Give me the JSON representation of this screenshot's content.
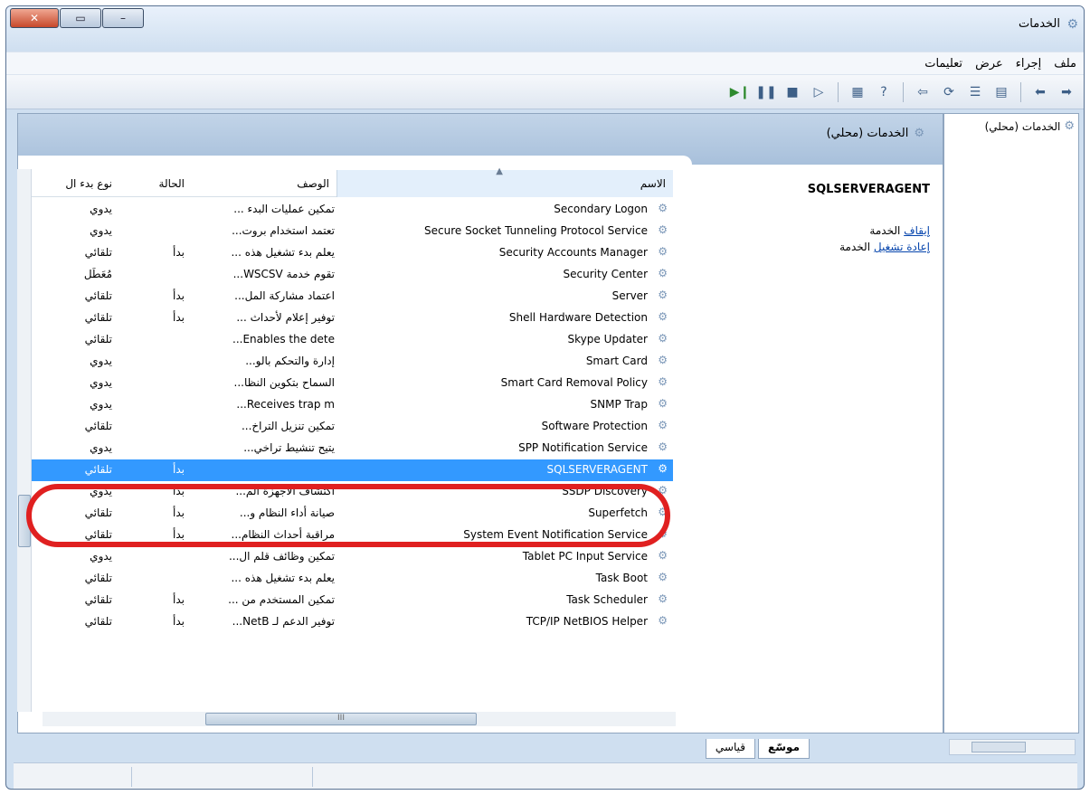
{
  "window": {
    "title": "الخدمات"
  },
  "menu": [
    "ملف",
    "إجراء",
    "عرض",
    "تعليمات"
  ],
  "tree": {
    "root": "الخدمات (محلي)"
  },
  "header": {
    "title": "الخدمات (محلي)"
  },
  "extended": {
    "service_name": "SQLSERVERAGENT",
    "stop_word": "إيقاف",
    "stop_rest": "الخدمة",
    "restart_word": "إعادة تشغيل",
    "restart_rest": "الخدمة"
  },
  "columns": {
    "name": "الاسم",
    "description": "الوصف",
    "status": "الحالة",
    "startup": "نوع بدء ال"
  },
  "rows": [
    {
      "name": "Secondary Logon",
      "desc": "تمكين عمليات البدء ...",
      "status": "",
      "startup": "يدوي"
    },
    {
      "name": "Secure Socket Tunneling Protocol Service",
      "desc": "تعتمد استخدام بروت...",
      "status": "",
      "startup": "يدوي"
    },
    {
      "name": "Security Accounts Manager",
      "desc": "يعلم بدء تشغيل هذه ...",
      "status": "بدأ",
      "startup": "تلقائي"
    },
    {
      "name": "Security Center",
      "desc": "تقوم خدمة WSCSV...",
      "status": "",
      "startup": "مُعَطَل"
    },
    {
      "name": "Server",
      "desc": "اعتماد مشاركة المل...",
      "status": "بدأ",
      "startup": "تلقائي"
    },
    {
      "name": "Shell Hardware Detection",
      "desc": "توفير إعلام لأحداث ...",
      "status": "بدأ",
      "startup": "تلقائي"
    },
    {
      "name": "Skype Updater",
      "desc": "Enables the dete...",
      "status": "",
      "startup": "تلقائي"
    },
    {
      "name": "Smart Card",
      "desc": "إدارة والتحكم بالو...",
      "status": "",
      "startup": "يدوي"
    },
    {
      "name": "Smart Card Removal Policy",
      "desc": "السماح بتكوين النظا...",
      "status": "",
      "startup": "يدوي"
    },
    {
      "name": "SNMP Trap",
      "desc": "Receives trap m...",
      "status": "",
      "startup": "يدوي"
    },
    {
      "name": "Software Protection",
      "desc": "تمكين تنزيل التراخ...",
      "status": "",
      "startup": "تلقائي"
    },
    {
      "name": "SPP Notification Service",
      "desc": "يتيح تنشيط تراخي...",
      "status": "",
      "startup": "يدوي"
    },
    {
      "name": "SQLSERVERAGENT",
      "desc": "",
      "status": "بدأ",
      "startup": "تلقائي"
    },
    {
      "name": "SSDP Discovery",
      "desc": "اكتشاف الأجهزة الم...",
      "status": "بدأ",
      "startup": "يدوي"
    },
    {
      "name": "Superfetch",
      "desc": "صيانة أداء النظام و...",
      "status": "بدأ",
      "startup": "تلقائي"
    },
    {
      "name": "System Event Notification Service",
      "desc": "مراقبة أحداث النظام...",
      "status": "بدأ",
      "startup": "تلقائي"
    },
    {
      "name": "Tablet PC Input Service",
      "desc": "تمكين وظائف قلم ال...",
      "status": "",
      "startup": "يدوي"
    },
    {
      "name": "Task Boot",
      "desc": "يعلم بدء تشغيل هذه ...",
      "status": "",
      "startup": "تلقائي"
    },
    {
      "name": "Task Scheduler",
      "desc": "تمكين المستخدم من ...",
      "status": "بدأ",
      "startup": "تلقائي"
    },
    {
      "name": "TCP/IP NetBIOS Helper",
      "desc": "توفير الدعم لـ NetB...",
      "status": "بدأ",
      "startup": "تلقائي"
    }
  ],
  "selected_index": 12,
  "tabs": {
    "extended": "موسّع",
    "standard": "قياسي"
  },
  "scroll_thumb": "III"
}
